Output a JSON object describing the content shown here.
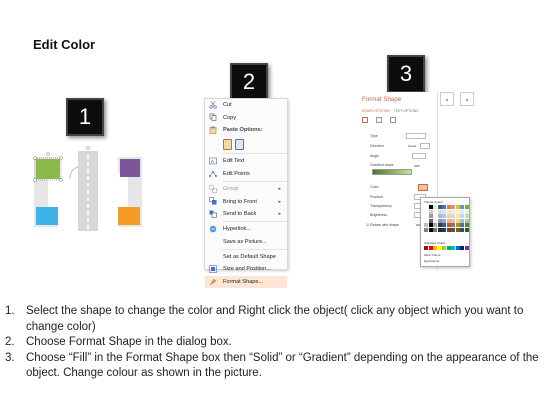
{
  "title": "Edit Color",
  "badges": [
    "1",
    "2",
    "3"
  ],
  "context_menu": {
    "items": [
      {
        "label": "Cut",
        "icon": "scissors-icon"
      },
      {
        "label": "Copy",
        "icon": "copy-icon"
      },
      {
        "label": "Paste Options:",
        "icon": "paste-icon"
      },
      {
        "label": "Edit Text",
        "icon": "edit-text-icon"
      },
      {
        "label": "Edit Points",
        "icon": "edit-points-icon"
      },
      {
        "label": "Group",
        "icon": "group-icon"
      },
      {
        "label": "Bring to Front",
        "icon": "bring-front-icon"
      },
      {
        "label": "Send to Back",
        "icon": "send-back-icon"
      },
      {
        "label": "Hyperlink...",
        "icon": "hyperlink-icon"
      },
      {
        "label": "Save as Picture...",
        "icon": ""
      },
      {
        "label": "Set as Default Shape",
        "icon": ""
      },
      {
        "label": "Size and Position...",
        "icon": "size-icon"
      },
      {
        "label": "Format Shape...",
        "icon": "format-shape-icon"
      }
    ]
  },
  "format_pane": {
    "title": "Format Shape",
    "tab_shape": "SHAPE OPTIONS",
    "tab_text": "TEXT OPTIONS",
    "rows": [
      "Type",
      "Direction",
      "Angle",
      "Gradient stops",
      "Color",
      "Position",
      "Transparency",
      "Brightness",
      "Rotate with shape"
    ],
    "type_value": "Linear",
    "angle_value": "225°",
    "position_value": "0%",
    "transparency_value": "0%",
    "brightness_value": "0%"
  },
  "palette": {
    "theme_label": "Theme Colors",
    "standard_label": "Standard Colors",
    "more_label": "More Colors...",
    "eyedropper_label": "Eyedropper",
    "theme_colors": [
      "#ffffff",
      "#000000",
      "#e7e6e6",
      "#44546a",
      "#4472c4",
      "#ed7d31",
      "#a5a5a5",
      "#ffc000",
      "#5b9bd5",
      "#70ad47"
    ],
    "standard_colors": [
      "#c00000",
      "#ff0000",
      "#ffc000",
      "#ffff00",
      "#92d050",
      "#00b050",
      "#00b0f0",
      "#0070c0",
      "#002060",
      "#7030a0"
    ]
  },
  "shape_colors": {
    "green": "#8cba4a",
    "purple": "#7c569b",
    "blue": "#3fb2e8",
    "orange": "#f39b24",
    "gray": "#e6e6e6"
  },
  "steps": [
    {
      "n": "1.",
      "text": "Select the shape to change the color and Right click the object( click any object which you want to change color)"
    },
    {
      "n": "2.",
      "text": "Choose Format Shape in the dialog box."
    },
    {
      "n": "3.",
      "text": "Choose “Fill” in the Format Shape box then “Solid” or “Gradient” depending on the appearance of the object. Change colour as shown in the picture."
    }
  ]
}
